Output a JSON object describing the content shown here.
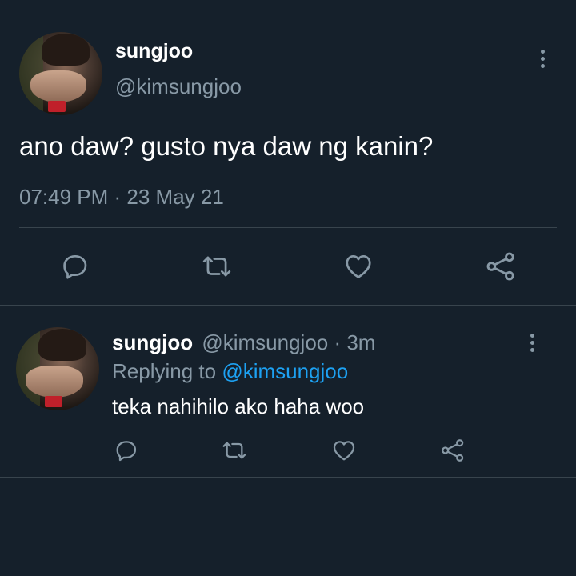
{
  "main_tweet": {
    "display_name": "sungjoo",
    "handle": "@kimsungjoo",
    "text": "ano daw? gusto nya daw ng kanin?",
    "timestamp": "07:49 PM · 23 May 21"
  },
  "reply_tweet": {
    "display_name": "sungjoo",
    "handle": "@kimsungjoo",
    "time_sep": " · ",
    "time": "3m",
    "replying_prefix": "Replying to ",
    "replying_to": "@kimsungjoo",
    "text": "teka nahihilo ako haha woo"
  },
  "icons": {
    "reply": "reply-icon",
    "retweet": "retweet-icon",
    "like": "heart-icon",
    "share": "share-icon",
    "more": "more-vertical-icon"
  },
  "colors": {
    "background": "#15202b",
    "secondary_text": "#8899a6",
    "link": "#1da1f2",
    "divider": "#38444d"
  }
}
